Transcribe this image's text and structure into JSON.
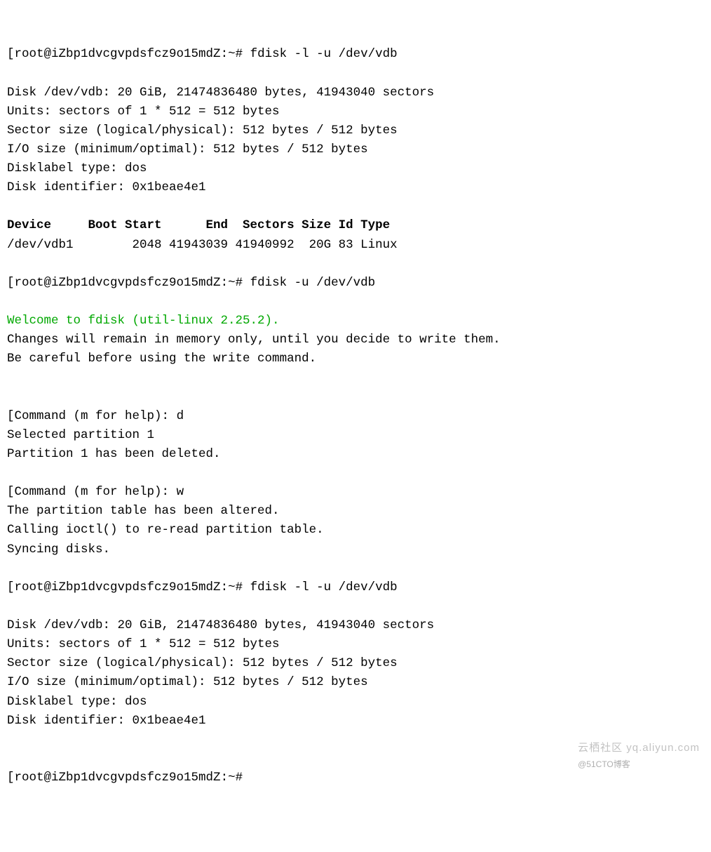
{
  "prompt1": {
    "bracket_open": "[",
    "user_host": "root@iZbp1dvcgvpdsfcz9o15mdZ:~#",
    "cmd": " fdisk -l -u /dev/vdb"
  },
  "diskinfo1": {
    "line1": "Disk /dev/vdb: 20 GiB, 21474836480 bytes, 41943040 sectors",
    "line2": "Units: sectors of 1 * 512 = 512 bytes",
    "line3": "Sector size (logical/physical): 512 bytes / 512 bytes",
    "line4": "I/O size (minimum/optimal): 512 bytes / 512 bytes",
    "line5": "Disklabel type: dos",
    "line6": "Disk identifier: 0x1beae4e1"
  },
  "table": {
    "header": "Device     Boot Start      End  Sectors Size Id Type",
    "row1": "/dev/vdb1        2048 41943039 41940992  20G 83 Linux"
  },
  "prompt2": {
    "bracket_open": "[",
    "user_host": "root@iZbp1dvcgvpdsfcz9o15mdZ:~#",
    "cmd": " fdisk -u /dev/vdb"
  },
  "welcome": "Welcome to fdisk (util-linux 2.25.2).",
  "changes_line": "Changes will remain in memory only, until you decide to write them.",
  "careful_line": "Be careful before using the write command.",
  "cmd_d": {
    "bracket_open": "[",
    "prompt": "Command (m for help): ",
    "input": "d"
  },
  "selected": "Selected partition 1",
  "deleted": "Partition 1 has been deleted.",
  "cmd_w": {
    "bracket_open": "[",
    "prompt": "Command (m for help): ",
    "input": "w"
  },
  "altered": "The partition table has been altered.",
  "ioctl": "Calling ioctl() to re-read partition table.",
  "syncing": "Syncing disks.",
  "prompt3": {
    "bracket_open": "[",
    "user_host": "root@iZbp1dvcgvpdsfcz9o15mdZ:~#",
    "cmd": " fdisk -l -u /dev/vdb"
  },
  "diskinfo2": {
    "line1": "Disk /dev/vdb: 20 GiB, 21474836480 bytes, 41943040 sectors",
    "line2": "Units: sectors of 1 * 512 = 512 bytes",
    "line3": "Sector size (logical/physical): 512 bytes / 512 bytes",
    "line4": "I/O size (minimum/optimal): 512 bytes / 512 bytes",
    "line5": "Disklabel type: dos",
    "line6": "Disk identifier: 0x1beae4e1"
  },
  "prompt4": {
    "bracket_open": "[",
    "user_host": "root@iZbp1dvcgvpdsfcz9o15mdZ:~#"
  },
  "watermark": {
    "cn": "云栖社区 yq.aliyun.com",
    "small": "@51CTO博客"
  }
}
